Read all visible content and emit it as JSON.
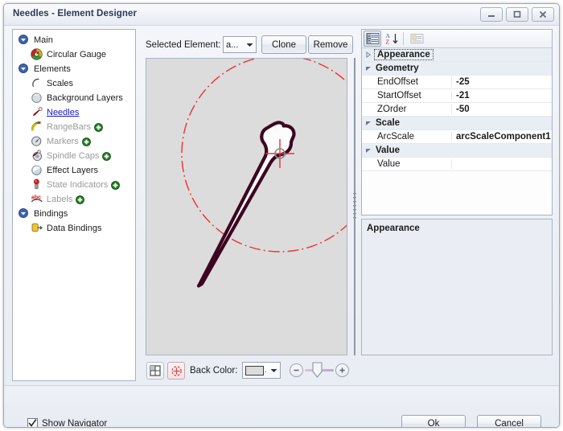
{
  "window": {
    "title": "Needles - Element Designer",
    "controls": {
      "minimize": "minimize-icon",
      "maximize": "maximize-icon",
      "close": "close-icon"
    }
  },
  "tree": {
    "items": [
      {
        "label": "Main",
        "icon": "expander-open-icon",
        "depth": 0,
        "kind": "group",
        "state": "normal"
      },
      {
        "label": "Circular Gauge",
        "icon": "circular-gauge-icon",
        "depth": 1,
        "kind": "leaf",
        "state": "normal"
      },
      {
        "label": "Elements",
        "icon": "expander-open-icon",
        "depth": 0,
        "kind": "group",
        "state": "normal"
      },
      {
        "label": "Scales",
        "icon": "scales-icon",
        "depth": 1,
        "kind": "leaf",
        "state": "normal"
      },
      {
        "label": "Background Layers",
        "icon": "background-layers-icon",
        "depth": 1,
        "kind": "leaf",
        "state": "normal"
      },
      {
        "label": "Needles",
        "icon": "needles-icon",
        "depth": 1,
        "kind": "leaf",
        "state": "selected"
      },
      {
        "label": "RangeBars",
        "icon": "rangebars-icon",
        "depth": 1,
        "kind": "leaf",
        "state": "dim",
        "add": true
      },
      {
        "label": "Markers",
        "icon": "markers-icon",
        "depth": 1,
        "kind": "leaf",
        "state": "dim",
        "add": true
      },
      {
        "label": "Spindle Caps",
        "icon": "spindle-caps-icon",
        "depth": 1,
        "kind": "leaf",
        "state": "dim",
        "add": true
      },
      {
        "label": "Effect Layers",
        "icon": "effect-layers-icon",
        "depth": 1,
        "kind": "leaf",
        "state": "normal"
      },
      {
        "label": "State Indicators",
        "icon": "state-indicators-icon",
        "depth": 1,
        "kind": "leaf",
        "state": "dim",
        "add": true
      },
      {
        "label": "Labels",
        "icon": "labels-icon",
        "depth": 1,
        "kind": "leaf",
        "state": "dim",
        "add": true
      },
      {
        "label": "Bindings",
        "icon": "expander-open-icon",
        "depth": 0,
        "kind": "group",
        "state": "normal"
      },
      {
        "label": "Data Bindings",
        "icon": "data-bindings-icon",
        "depth": 1,
        "kind": "leaf",
        "state": "normal"
      }
    ]
  },
  "toolbar": {
    "selected_element_label": "Selected Element:",
    "selected_element_value": "a...",
    "clone_label": "Clone",
    "remove_label": "Remove"
  },
  "canvas": {
    "background_color": "#dcdcdc",
    "needle_outline_color": "#3d0620",
    "needle_fill_color": "#fcfcfc",
    "guide_color": "#f03030"
  },
  "canvas_toolbar": {
    "grid_button": "layout-grid-icon",
    "center_button": "center-target-icon",
    "back_color_label": "Back Color:",
    "back_color_value": "#dcdcdc",
    "zoom_out_label": "−",
    "zoom_in_label": "+"
  },
  "property_grid": {
    "toolbar": {
      "categorized_label": "categorized-view-icon",
      "alphabetical_label": "alphabetical-sort-icon",
      "property_pages_label": "property-pages-icon"
    },
    "rows": [
      {
        "type": "category",
        "name": "Appearance",
        "expanded": false,
        "focused": true
      },
      {
        "type": "category",
        "name": "Geometry",
        "expanded": true,
        "focused": false
      },
      {
        "type": "property",
        "name": "EndOffset",
        "value": "-25"
      },
      {
        "type": "property",
        "name": "StartOffset",
        "value": "-21"
      },
      {
        "type": "property",
        "name": "ZOrder",
        "value": "-50"
      },
      {
        "type": "category",
        "name": "Scale",
        "expanded": true,
        "focused": false
      },
      {
        "type": "property",
        "name": "ArcScale",
        "value": "arcScaleComponent1"
      },
      {
        "type": "category",
        "name": "Value",
        "expanded": true,
        "focused": false
      },
      {
        "type": "property",
        "name": "Value",
        "value": ""
      }
    ]
  },
  "description": {
    "title": "Appearance",
    "text": ""
  },
  "footer": {
    "show_navigator_label": "Show Navigator",
    "show_navigator_checked": true,
    "ok_label": "Ok",
    "cancel_label": "Cancel"
  }
}
